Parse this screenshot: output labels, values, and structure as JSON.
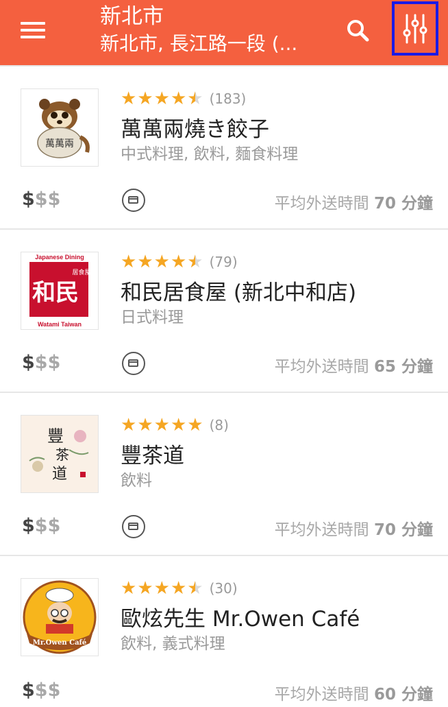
{
  "header": {
    "title": "新北市",
    "subtitle": "新北市, 長江路一段 (...",
    "menu_icon": "hamburger-menu-icon",
    "search_icon": "search-icon",
    "filter_icon": "filter-sliders-icon",
    "background_color": "#f4603f",
    "highlight_color": "#1a1ae6"
  },
  "restaurants": [
    {
      "name": "萬萬兩燒き餃子",
      "rating": 4.5,
      "stars": [
        "★",
        "★",
        "★",
        "★",
        "★"
      ],
      "review_count": "(183)",
      "cuisines": "中式料理, 飲料, 麵食料理",
      "price_on": "$",
      "price_off": "$$",
      "delivery_label": "平均外送時間",
      "delivery_time": "70 分鐘"
    },
    {
      "name": "和民居食屋 (新北中和店)",
      "rating": 4.5,
      "stars": [
        "★",
        "★",
        "★",
        "★",
        "★"
      ],
      "review_count": "(79)",
      "cuisines": "日式料理",
      "price_on": "$",
      "price_off": "$$",
      "delivery_label": "平均外送時間",
      "delivery_time": "65 分鐘"
    },
    {
      "name": "豐茶道",
      "rating": 5,
      "stars": [
        "★",
        "★",
        "★",
        "★",
        "★"
      ],
      "review_count": "(8)",
      "cuisines": "飲料",
      "price_on": "$",
      "price_off": "$$",
      "delivery_label": "平均外送時間",
      "delivery_time": "70 分鐘"
    },
    {
      "name": "歐炫先生 Mr.Owen Café",
      "rating": 4.5,
      "stars": [
        "★",
        "★",
        "★",
        "★",
        "★"
      ],
      "review_count": "(30)",
      "cuisines": "飲料, 義式料理",
      "price_on": "$",
      "price_off": "$$",
      "delivery_label": "平均外送時間",
      "delivery_time": "60 分鐘"
    }
  ],
  "logos": {
    "watami_top": "Japanese Dining",
    "watami_bottom": "Watami Taiwan",
    "owen_banner": "Mr.Owen Café"
  },
  "colors": {
    "star": "#f5a623",
    "star_empty": "#d9d9d9"
  }
}
